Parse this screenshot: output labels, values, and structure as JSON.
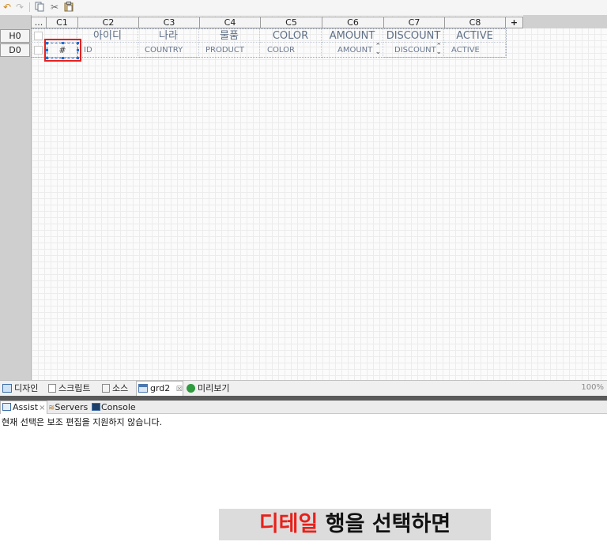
{
  "toolbar": {
    "icons": [
      "undo-icon",
      "redo-icon",
      "copy-icon",
      "cut-icon",
      "paste-icon"
    ]
  },
  "grid": {
    "corner_label": "...",
    "add_column_label": "+",
    "columns": [
      "C1",
      "C2",
      "C3",
      "C4",
      "C5",
      "C6",
      "C7",
      "C8"
    ],
    "rows": [
      "H0",
      "D0"
    ],
    "header_cells": [
      "",
      "아이디",
      "나라",
      "물품",
      "COLOR",
      "AMOUNT",
      "DISCOUNT",
      "ACTIVE"
    ],
    "detail_cells": [
      "#",
      "ID",
      "COUNTRY",
      "PRODUCT",
      "COLOR",
      "AMOUNT",
      "DISCOUNT",
      "ACTIVE"
    ],
    "spinner_glyph": "⌃⌄",
    "selected_cell": "C1-D0"
  },
  "editor_tabs": {
    "design": "디자인",
    "script": "스크립트",
    "source": "소스",
    "grd2": "grd2",
    "grd2_close": "☒",
    "preview": "미리보기",
    "zoom": "100%"
  },
  "panel": {
    "tabs": [
      "Assist",
      "Servers",
      "Console"
    ],
    "assist_close": "×",
    "message": "현재 선택은 보조 편집을 지원하지 않습니다."
  },
  "subtitle": {
    "highlight": "디테일",
    "rest": " 행을 선택하면",
    "highlight_color": "#e8201a"
  }
}
